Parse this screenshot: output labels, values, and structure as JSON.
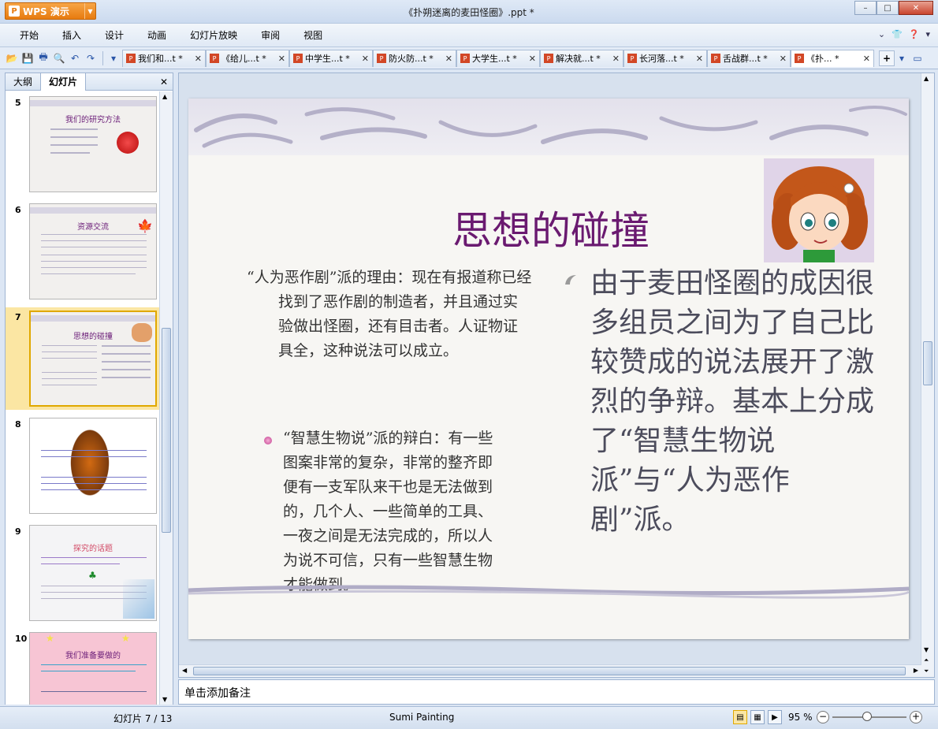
{
  "app": {
    "name": "WPS 演示",
    "logo_glyph": "P"
  },
  "window": {
    "title": "《扑朔迷离的麦田怪圈》.ppt *"
  },
  "menu": [
    "开始",
    "插入",
    "设计",
    "动画",
    "幻灯片放映",
    "审阅",
    "视图"
  ],
  "tabs": [
    {
      "label": "我们和...t *"
    },
    {
      "label": "《给儿...t *"
    },
    {
      "label": "中学生...t *"
    },
    {
      "label": "防火防...t *"
    },
    {
      "label": "大学生...t *"
    },
    {
      "label": "解决就...t *"
    },
    {
      "label": "长河落...t *"
    },
    {
      "label": "舌战群...t *"
    },
    {
      "label": "《扑... *",
      "active": true
    }
  ],
  "left_panel": {
    "tabs": [
      "大纲",
      "幻灯片"
    ],
    "active_tab": "幻灯片",
    "thumbnails": [
      {
        "number": "5",
        "title": "我们的研究方法",
        "bg": "#f2f0ee"
      },
      {
        "number": "6",
        "title": "资源交流",
        "bg": "#f2f0ee"
      },
      {
        "number": "7",
        "title": "思想的碰撞",
        "bg": "#f2f0ee",
        "selected": true
      },
      {
        "number": "8",
        "title": "",
        "bg": "#ffffff"
      },
      {
        "number": "9",
        "title": "探究的话题",
        "bg": "#f4f4f6"
      },
      {
        "number": "10",
        "title": "我们准备要做的",
        "bg": "#f7c5d4"
      }
    ]
  },
  "slide": {
    "title": "思想的碰撞",
    "left_paragraph": "“人为恶作剧”派的理由：现在有报道称已经找到了恶作剧的制造者，并且通过实验做出怪圈，还有目击者。人证物证具全，这种说法可以成立。",
    "mid_paragraph": "“智慧生物说”派的辩白：有一些图案非常的复杂，非常的整齐即便有一支军队来干也是无法做到的，几个人、一些简单的工具、一夜之间是无法完成的，所以人为说不可信，只有一些智慧生物才能做到。",
    "right_paragraph": "由于麦田怪圈的成因很多组员之间为了自己比较赞成的说法展开了激烈的争辩。基本上分成了“智慧生物说派”与“人为恶作剧”派。"
  },
  "notes": {
    "placeholder": "单击添加备注"
  },
  "status": {
    "slide_counter": "幻灯片 7 / 13",
    "theme": "Sumi Painting",
    "zoom": "95 %"
  },
  "colors": {
    "title_purple": "#6a1a70",
    "accent_orange": "#e77b0f"
  }
}
